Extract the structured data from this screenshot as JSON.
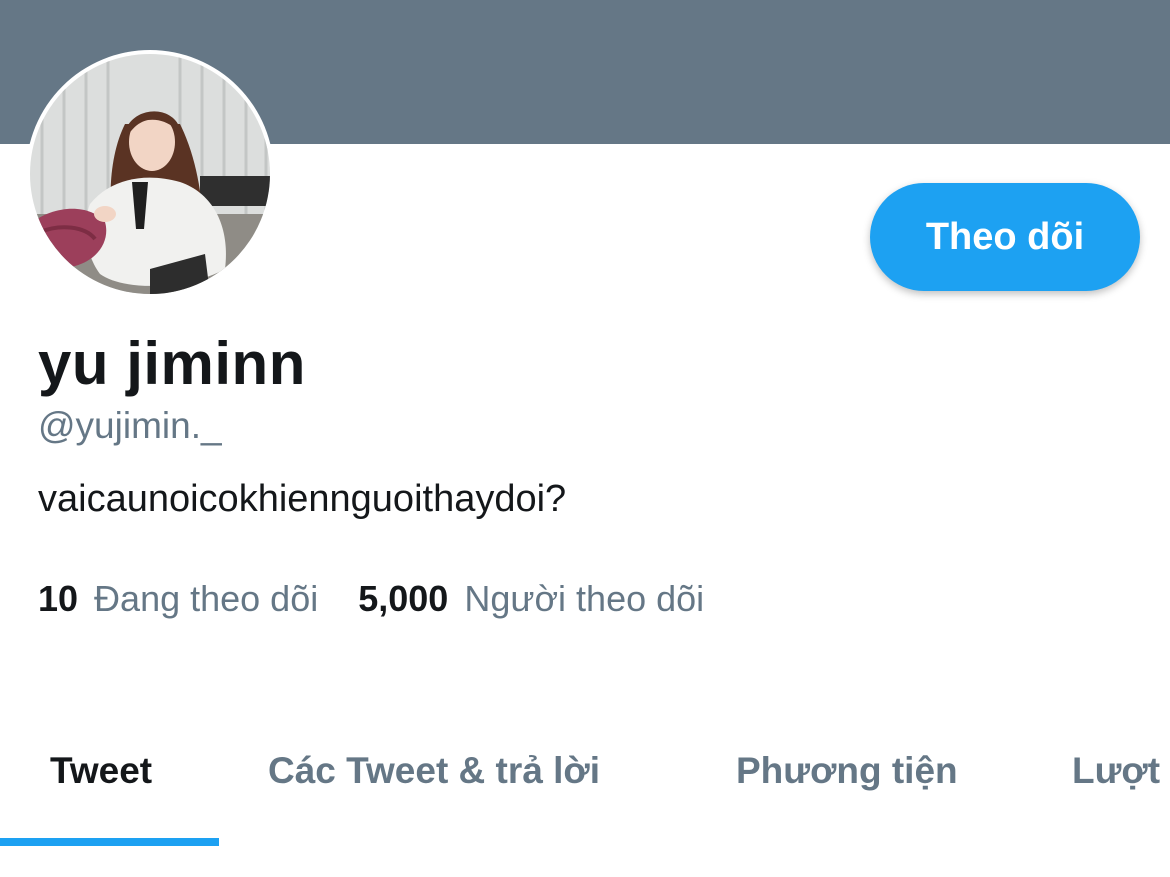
{
  "profile": {
    "display_name": "yu jiminn",
    "handle": "@yujimin._",
    "bio": "vaicaunoicokhiennguoithaydoi?",
    "follow_button_label": "Theo dõi"
  },
  "stats": {
    "following_count": "10",
    "following_label": "Đang theo dõi",
    "followers_count": "5,000",
    "followers_label": "Người theo dõi"
  },
  "tabs": [
    {
      "label": "Tweet",
      "active": true
    },
    {
      "label": "Các Tweet & trả lời",
      "active": false
    },
    {
      "label": "Phương tiện",
      "active": false
    },
    {
      "label": "Lượt",
      "active": false
    }
  ],
  "colors": {
    "banner": "#657786",
    "accent": "#1da1f2",
    "primary_text": "#14171a",
    "secondary_text": "#657786"
  }
}
